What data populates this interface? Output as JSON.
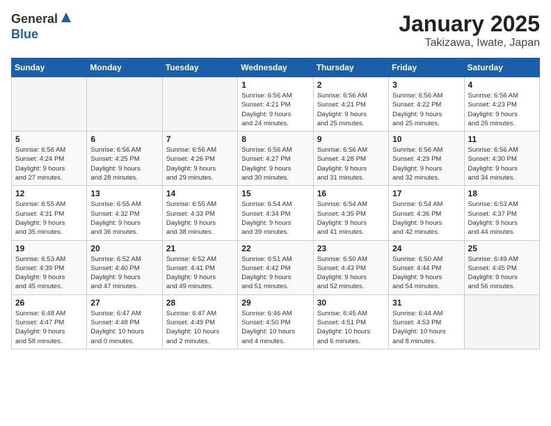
{
  "header": {
    "logo_general": "General",
    "logo_blue": "Blue",
    "title": "January 2025",
    "subtitle": "Takizawa, Iwate, Japan"
  },
  "calendar": {
    "weekdays": [
      "Sunday",
      "Monday",
      "Tuesday",
      "Wednesday",
      "Thursday",
      "Friday",
      "Saturday"
    ],
    "weeks": [
      [
        {
          "day": "",
          "info": ""
        },
        {
          "day": "",
          "info": ""
        },
        {
          "day": "",
          "info": ""
        },
        {
          "day": "1",
          "info": "Sunrise: 6:56 AM\nSunset: 4:21 PM\nDaylight: 9 hours\nand 24 minutes."
        },
        {
          "day": "2",
          "info": "Sunrise: 6:56 AM\nSunset: 4:21 PM\nDaylight: 9 hours\nand 25 minutes."
        },
        {
          "day": "3",
          "info": "Sunrise: 6:56 AM\nSunset: 4:22 PM\nDaylight: 9 hours\nand 25 minutes."
        },
        {
          "day": "4",
          "info": "Sunrise: 6:56 AM\nSunset: 4:23 PM\nDaylight: 9 hours\nand 26 minutes."
        }
      ],
      [
        {
          "day": "5",
          "info": "Sunrise: 6:56 AM\nSunset: 4:24 PM\nDaylight: 9 hours\nand 27 minutes."
        },
        {
          "day": "6",
          "info": "Sunrise: 6:56 AM\nSunset: 4:25 PM\nDaylight: 9 hours\nand 28 minutes."
        },
        {
          "day": "7",
          "info": "Sunrise: 6:56 AM\nSunset: 4:26 PM\nDaylight: 9 hours\nand 29 minutes."
        },
        {
          "day": "8",
          "info": "Sunrise: 6:56 AM\nSunset: 4:27 PM\nDaylight: 9 hours\nand 30 minutes."
        },
        {
          "day": "9",
          "info": "Sunrise: 6:56 AM\nSunset: 4:28 PM\nDaylight: 9 hours\nand 31 minutes."
        },
        {
          "day": "10",
          "info": "Sunrise: 6:56 AM\nSunset: 4:29 PM\nDaylight: 9 hours\nand 32 minutes."
        },
        {
          "day": "11",
          "info": "Sunrise: 6:56 AM\nSunset: 4:30 PM\nDaylight: 9 hours\nand 34 minutes."
        }
      ],
      [
        {
          "day": "12",
          "info": "Sunrise: 6:55 AM\nSunset: 4:31 PM\nDaylight: 9 hours\nand 35 minutes."
        },
        {
          "day": "13",
          "info": "Sunrise: 6:55 AM\nSunset: 4:32 PM\nDaylight: 9 hours\nand 36 minutes."
        },
        {
          "day": "14",
          "info": "Sunrise: 6:55 AM\nSunset: 4:33 PM\nDaylight: 9 hours\nand 38 minutes."
        },
        {
          "day": "15",
          "info": "Sunrise: 6:54 AM\nSunset: 4:34 PM\nDaylight: 9 hours\nand 39 minutes."
        },
        {
          "day": "16",
          "info": "Sunrise: 6:54 AM\nSunset: 4:35 PM\nDaylight: 9 hours\nand 41 minutes."
        },
        {
          "day": "17",
          "info": "Sunrise: 6:54 AM\nSunset: 4:36 PM\nDaylight: 9 hours\nand 42 minutes."
        },
        {
          "day": "18",
          "info": "Sunrise: 6:53 AM\nSunset: 4:37 PM\nDaylight: 9 hours\nand 44 minutes."
        }
      ],
      [
        {
          "day": "19",
          "info": "Sunrise: 6:53 AM\nSunset: 4:39 PM\nDaylight: 9 hours\nand 45 minutes."
        },
        {
          "day": "20",
          "info": "Sunrise: 6:52 AM\nSunset: 4:40 PM\nDaylight: 9 hours\nand 47 minutes."
        },
        {
          "day": "21",
          "info": "Sunrise: 6:52 AM\nSunset: 4:41 PM\nDaylight: 9 hours\nand 49 minutes."
        },
        {
          "day": "22",
          "info": "Sunrise: 6:51 AM\nSunset: 4:42 PM\nDaylight: 9 hours\nand 51 minutes."
        },
        {
          "day": "23",
          "info": "Sunrise: 6:50 AM\nSunset: 4:43 PM\nDaylight: 9 hours\nand 52 minutes."
        },
        {
          "day": "24",
          "info": "Sunrise: 6:50 AM\nSunset: 4:44 PM\nDaylight: 9 hours\nand 54 minutes."
        },
        {
          "day": "25",
          "info": "Sunrise: 6:49 AM\nSunset: 4:45 PM\nDaylight: 9 hours\nand 56 minutes."
        }
      ],
      [
        {
          "day": "26",
          "info": "Sunrise: 6:48 AM\nSunset: 4:47 PM\nDaylight: 9 hours\nand 58 minutes."
        },
        {
          "day": "27",
          "info": "Sunrise: 6:47 AM\nSunset: 4:48 PM\nDaylight: 10 hours\nand 0 minutes."
        },
        {
          "day": "28",
          "info": "Sunrise: 6:47 AM\nSunset: 4:49 PM\nDaylight: 10 hours\nand 2 minutes."
        },
        {
          "day": "29",
          "info": "Sunrise: 6:46 AM\nSunset: 4:50 PM\nDaylight: 10 hours\nand 4 minutes."
        },
        {
          "day": "30",
          "info": "Sunrise: 6:45 AM\nSunset: 4:51 PM\nDaylight: 10 hours\nand 6 minutes."
        },
        {
          "day": "31",
          "info": "Sunrise: 6:44 AM\nSunset: 4:53 PM\nDaylight: 10 hours\nand 8 minutes."
        },
        {
          "day": "",
          "info": ""
        }
      ]
    ]
  }
}
